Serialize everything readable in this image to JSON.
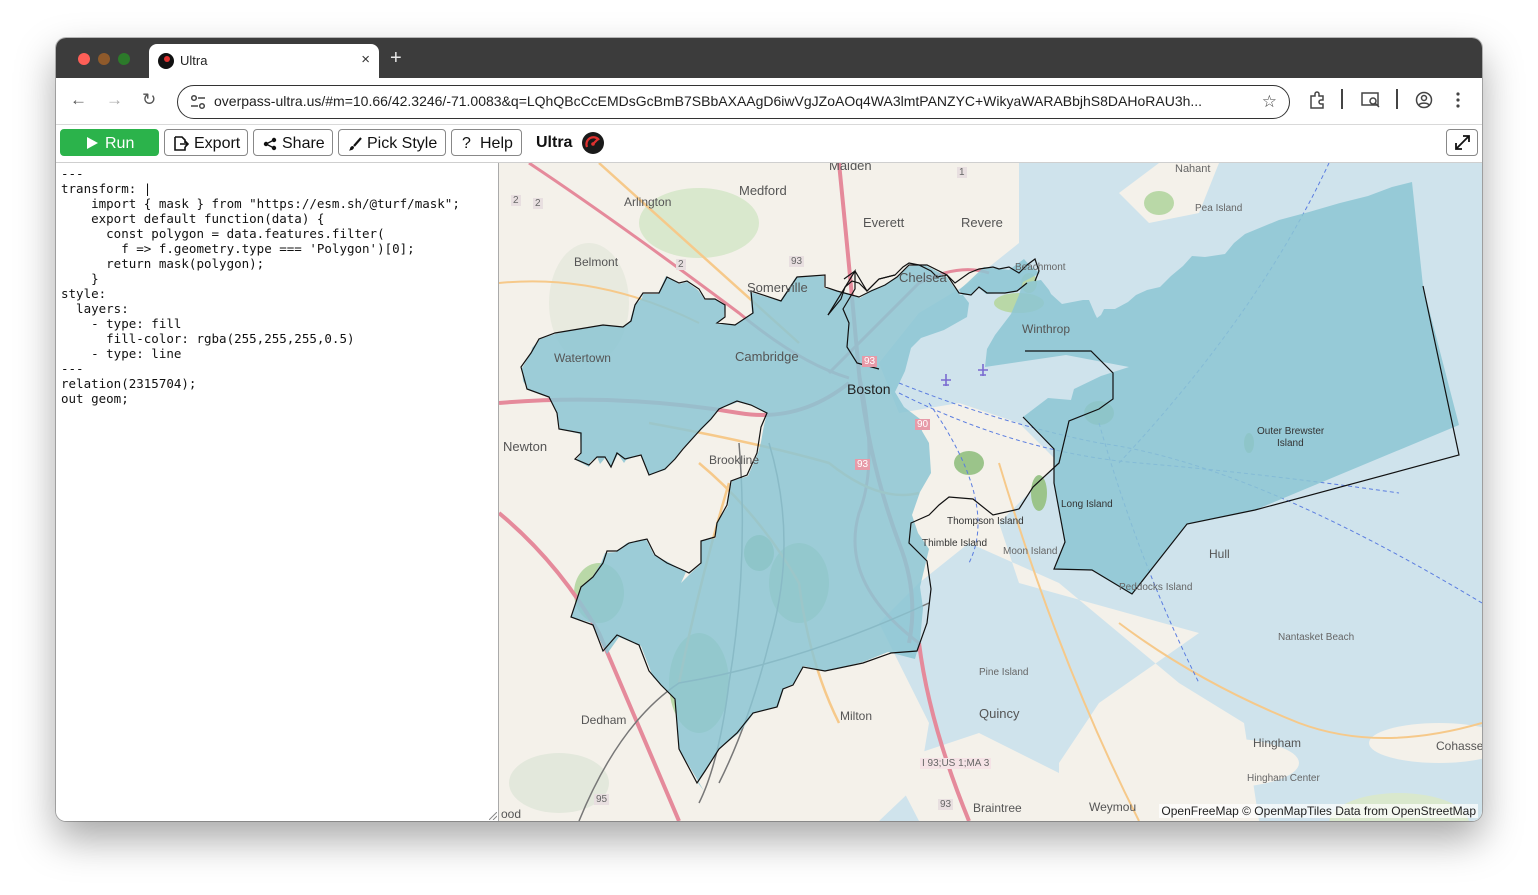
{
  "browser": {
    "tab_title": "Ultra",
    "tab_close": "×",
    "new_tab": "+",
    "url": "overpass-ultra.us/#m=10.66/42.3246/-71.0083&q=LQhQBcCcEMDsGcBmB7SBbAXAAgD6iwVgJZoAOq4WA3lmtPANZYC+WikyaWARABbjhS8DAHoRAU3h...",
    "nav": {
      "back": "←",
      "forward": "→",
      "reload": "↻"
    },
    "star_icon": "☆"
  },
  "app": {
    "buttons": {
      "run": "Run",
      "export": "Export",
      "share": "Share",
      "pick_style": "Pick Style",
      "help": "Help"
    },
    "brand": "Ultra"
  },
  "editor": {
    "code": "---\ntransform: |\n    import { mask } from \"https://esm.sh/@turf/mask\";\n    export default function(data) {\n      const polygon = data.features.filter(\n        f => f.geometry.type === 'Polygon')[0];\n      return mask(polygon);\n    }\nstyle:\n  layers:\n    - type: fill\n      fill-color: rgba(255,255,255,0.5)\n    - type: line\n---\nrelation(2315704);\nout geom;"
  },
  "map": {
    "labels": {
      "malden": "Malden",
      "medford": "Medford",
      "arlington": "Arlington",
      "everett": "Everett",
      "revere": "Revere",
      "nahant": "Nahant",
      "pea_island": "Pea Island",
      "belmont": "Belmont",
      "somerville": "Somerville",
      "chelsea": "Chelsea",
      "beachmont": "Beachmont",
      "winthrop": "Winthrop",
      "watertown": "Watertown",
      "cambridge": "Cambridge",
      "boston": "Boston",
      "newton": "Newton",
      "brookline": "Brookline",
      "outer_brewster": "Outer Brewster",
      "outer_brewster_2": "Island",
      "long_island": "Long Island",
      "thompson_island": "Thompson Island",
      "thimble_island": "Thimble Island",
      "moon_island": "Moon Island",
      "hull": "Hull",
      "peddocks_island": "Peddocks Island",
      "nantasket_beach": "Nantasket Beach",
      "dedham": "Dedham",
      "milton": "Milton",
      "quincy": "Quincy",
      "pine_island": "Pine Island",
      "hingham": "Hingham",
      "hingham_center": "Hingham Center",
      "cohasset": "Cohasse",
      "braintree": "Braintree",
      "weymouth": "Weymou",
      "wood": "ood",
      "route_i93": "I 93;US 1;MA 3"
    },
    "shields": {
      "s93a": "93",
      "s93b": "93",
      "s93c": "93",
      "s90": "90",
      "s2a": "2",
      "s2b": "2",
      "s2c": "2",
      "s1": "1",
      "s95": "95",
      "s93d": "93"
    },
    "attribution": {
      "prefix": "OpenFreeMap © OpenMapTiles",
      "middle": "Data from",
      "osm": "OpenStreetMap"
    }
  },
  "colors": {
    "run": "#2bb34b",
    "water": "#cfe3ec",
    "highlight": "rgba(140,198,212,0.85)",
    "land": "#f4f1ea",
    "park": "#b9d8a7",
    "road_major": "#e58a9b",
    "road_minor": "#f6c98a"
  }
}
